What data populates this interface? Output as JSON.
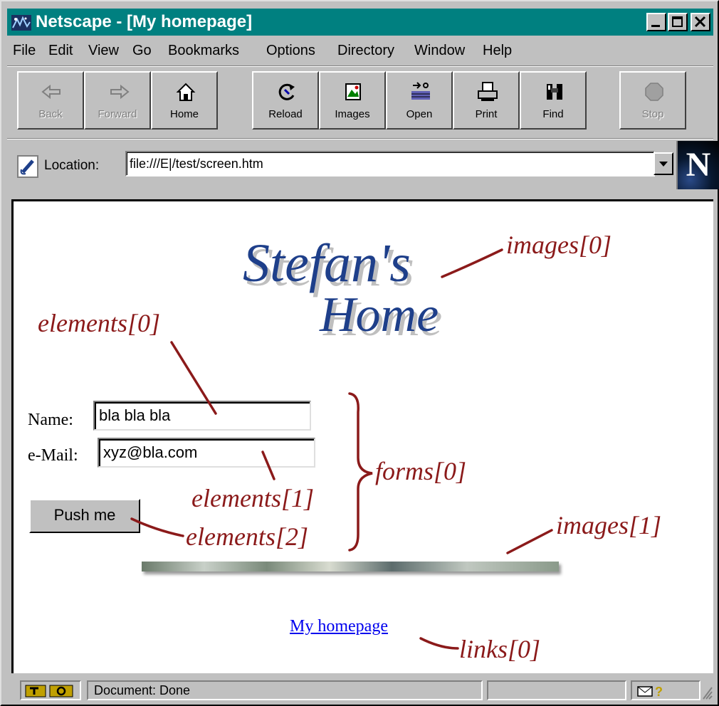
{
  "window": {
    "title": "Netscape - [My homepage]",
    "controls": [
      "minimize",
      "maximize",
      "close"
    ]
  },
  "menubar": {
    "items": [
      "File",
      "Edit",
      "View",
      "Go",
      "Bookmarks",
      "Options",
      "Directory",
      "Window",
      "Help"
    ]
  },
  "toolbar": {
    "buttons": [
      {
        "label": "Back",
        "icon": "back-arrow-icon",
        "enabled": false
      },
      {
        "label": "Forward",
        "icon": "forward-arrow-icon",
        "enabled": false
      },
      {
        "label": "Home",
        "icon": "home-icon",
        "enabled": true
      },
      {
        "label": "Reload",
        "icon": "reload-icon",
        "enabled": true
      },
      {
        "label": "Images",
        "icon": "images-icon",
        "enabled": true
      },
      {
        "label": "Open",
        "icon": "open-icon",
        "enabled": true
      },
      {
        "label": "Print",
        "icon": "printer-icon",
        "enabled": true
      },
      {
        "label": "Find",
        "icon": "binoculars-icon",
        "enabled": true
      },
      {
        "label": "Stop",
        "icon": "stop-icon",
        "enabled": false
      }
    ]
  },
  "location": {
    "label": "Location:",
    "url": "file:///E|/test/screen.htm"
  },
  "page": {
    "logo_line1": "Stefan's",
    "logo_line2": "Home",
    "form": {
      "name_label": "Name:",
      "name_value": "bla bla bla",
      "email_label": "e-Mail:",
      "email_value": "xyz@bla.com",
      "button_label": "Push me"
    },
    "link_text": "My homepage"
  },
  "annotations": {
    "images0": "images[0]",
    "elements0": "elements[0]",
    "forms0": "forms[0]",
    "elements1": "elements[1]",
    "elements2": "elements[2]",
    "images1": "images[1]",
    "links0": "links[0]",
    "color": "#8b1a1a"
  },
  "statusbar": {
    "text": "Document: Done"
  },
  "colors": {
    "titlebar": "#008080",
    "chrome": "#c0c0c0",
    "link": "#0000ee",
    "logo": "#1e3f8a"
  }
}
